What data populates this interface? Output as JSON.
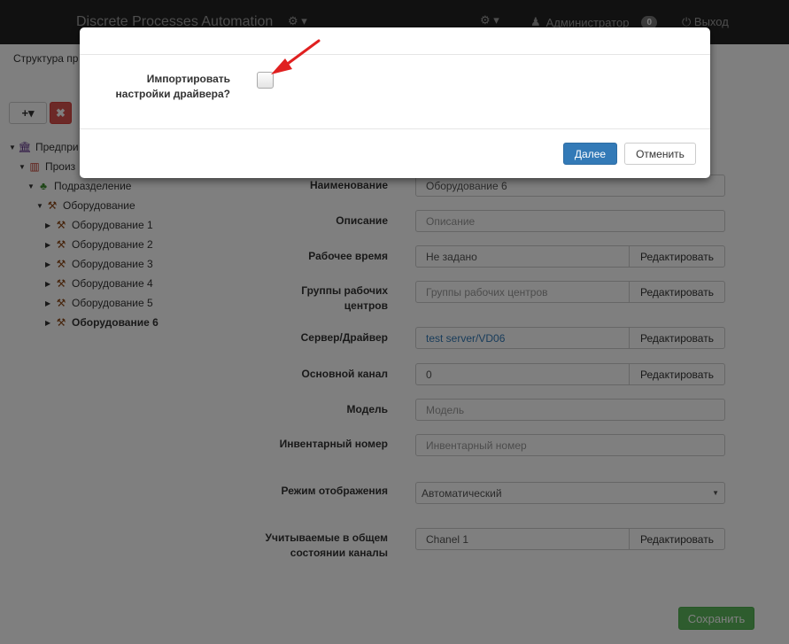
{
  "navbar": {
    "brand": "Discrete Processes Automation",
    "cogs_icon": "cogs-icon",
    "gear_icon": "gear-icon",
    "user_name": "Администратор",
    "badge_count": "0",
    "logout_label": "Выход"
  },
  "breadcrumb": "Структура пр",
  "toolbar": {
    "add_label": "+▾",
    "delete_label": "✖"
  },
  "tree": {
    "enterprise": "Предпри",
    "production": "Произ",
    "division": "Подразделение",
    "equipment_group": "Оборудование",
    "items": [
      "Оборудование 1",
      "Оборудование 2",
      "Оборудование 3",
      "Оборудование 4",
      "Оборудование 5",
      "Оборудование 6"
    ]
  },
  "form": {
    "name": {
      "label": "Наименование",
      "value": "Оборудование 6"
    },
    "description": {
      "label": "Описание",
      "placeholder": "Описание"
    },
    "worktime": {
      "label": "Рабочее время",
      "value": "Не задано",
      "button": "Редактировать"
    },
    "groups": {
      "label": "Группы рабочих центров",
      "placeholder": "Группы рабочих центров",
      "button": "Редактировать"
    },
    "server": {
      "label": "Сервер/Драйвер",
      "value": "test server/VD06",
      "button": "Редактировать"
    },
    "channel": {
      "label": "Основной канал",
      "value": "0",
      "button": "Редактировать"
    },
    "model": {
      "label": "Модель",
      "placeholder": "Модель"
    },
    "inventory": {
      "label": "Инвентарный номер",
      "placeholder": "Инвентарный номер"
    },
    "display_mode": {
      "label": "Режим отображения",
      "value": "Автоматический"
    },
    "channels": {
      "label": "Учитываемые в общем состоянии каналы",
      "value": "Chanel 1",
      "button": "Редактировать"
    }
  },
  "save_label": "Сохранить",
  "modal": {
    "question": "Импортировать настройки драйвера?",
    "next_label": "Далее",
    "cancel_label": "Отменить"
  },
  "colors": {
    "primary": "#337ab7",
    "success": "#5cb85c",
    "danger": "#d9534f",
    "navbar": "#222222",
    "arrow": "#e02020"
  }
}
